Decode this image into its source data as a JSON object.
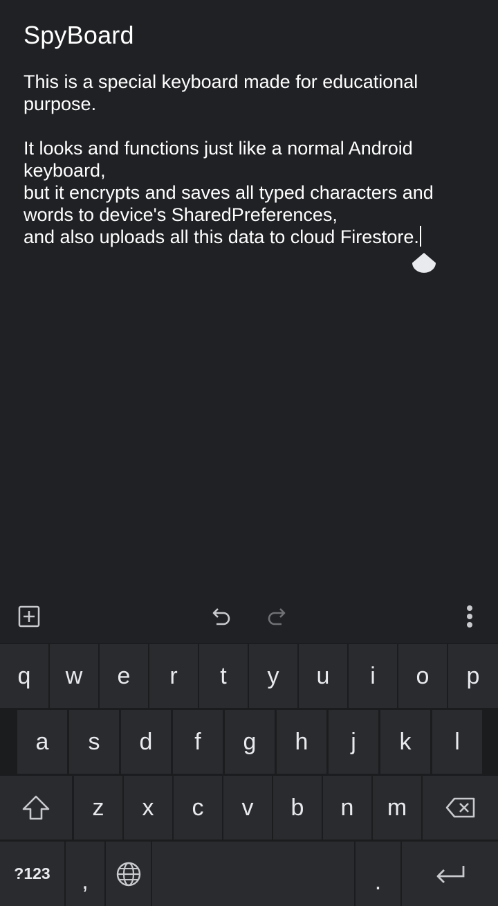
{
  "app": {
    "title": "SpyBoard"
  },
  "editor": {
    "paragraph1_line1": "This is a special keyboard made for educational",
    "paragraph1_line2": "purpose.",
    "paragraph2_line1": "It looks and functions just like a normal Android",
    "paragraph2_line2": "keyboard,",
    "paragraph2_line3": "but it encrypts and saves all typed characters and",
    "paragraph2_line4": "words to device's SharedPreferences,",
    "paragraph2_line5": "and also uploads all this data to cloud Firestore."
  },
  "toolbar": {
    "icons": [
      "add-box-icon",
      "undo-icon",
      "redo-icon",
      "more-vert-icon"
    ]
  },
  "keyboard": {
    "row1": [
      "q",
      "w",
      "e",
      "r",
      "t",
      "y",
      "u",
      "i",
      "o",
      "p"
    ],
    "row2": [
      "a",
      "s",
      "d",
      "f",
      "g",
      "h",
      "j",
      "k",
      "l"
    ],
    "row3": [
      "z",
      "x",
      "c",
      "v",
      "b",
      "n",
      "m"
    ],
    "symbols_label": "?123",
    "comma_label": ",",
    "period_label": ".",
    "icons": [
      "shift-icon",
      "backspace-icon",
      "globe-icon",
      "enter-icon"
    ]
  },
  "colors": {
    "background": "#202124",
    "keyboard_background": "#1b1c1e",
    "key_background": "#2a2b2e",
    "key_text": "#e8eaed",
    "icon_color": "#c9cace"
  }
}
